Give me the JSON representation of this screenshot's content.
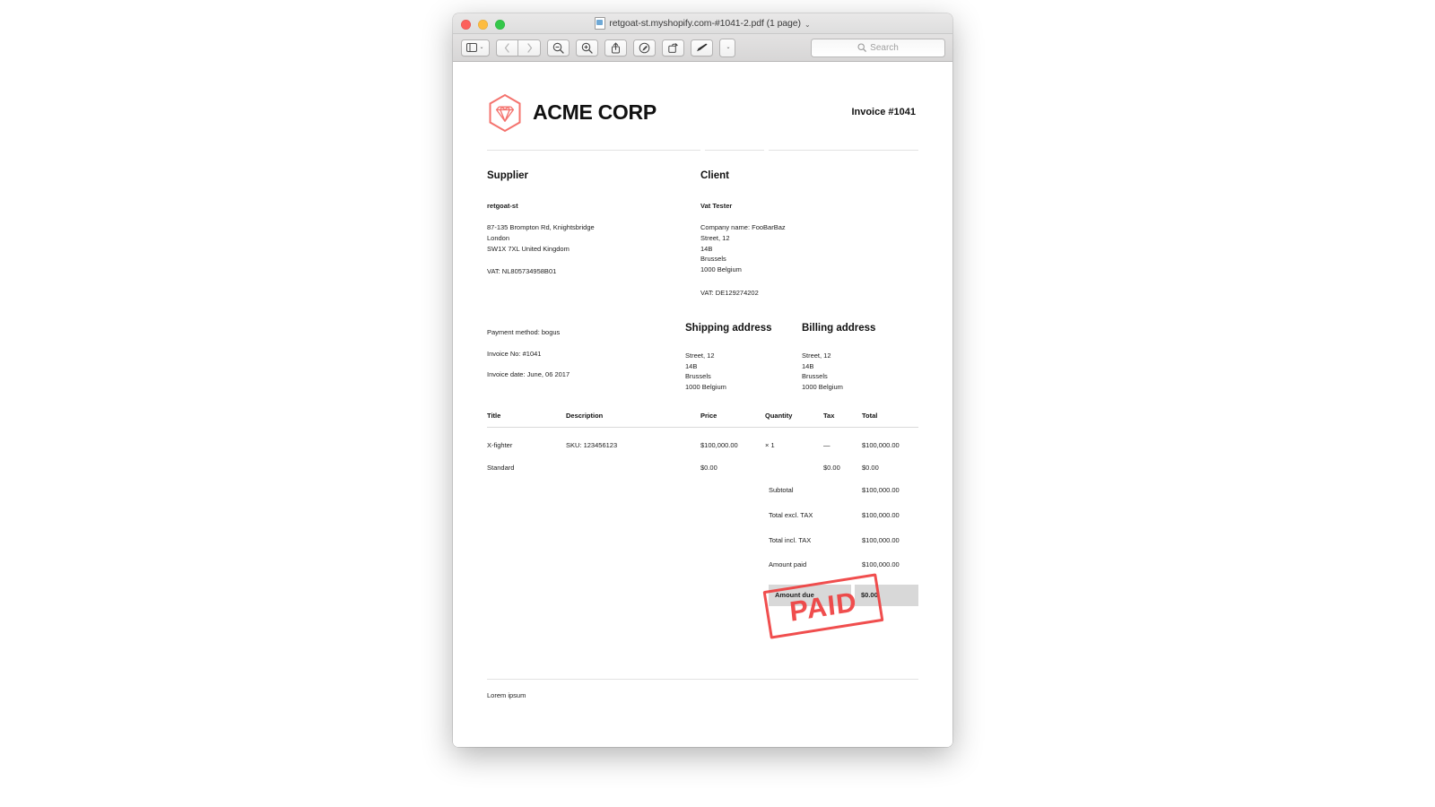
{
  "window": {
    "title": "retgoat-st.myshopify.com-#1041-2.pdf (1 page)",
    "title_chevron": "⌄",
    "traffic_lights": [
      "close",
      "minimize",
      "zoom"
    ]
  },
  "toolbar": {
    "sidebar_label": "Sidebar",
    "back_label": "Back",
    "forward_label": "Forward",
    "zoom_out_label": "Zoom Out",
    "zoom_in_label": "Zoom In",
    "share_label": "Share",
    "markup_label": "Markup",
    "rotate_label": "Rotate",
    "highlight_label": "Highlight",
    "highlight_caret": "⌄",
    "sidebar_caret": "⌄"
  },
  "search": {
    "placeholder": "Search"
  },
  "invoice": {
    "brand_name": "ACME CORP",
    "logo_color": "#f4736e",
    "invoice_number": "Invoice #1041",
    "supplier": {
      "heading": "Supplier",
      "name": "retgoat-st",
      "address": [
        "87-135 Brompton Rd, Knightsbridge",
        "London",
        "SW1X 7XL United Kingdom"
      ],
      "vat": "VAT: NL805734958B01"
    },
    "client": {
      "heading": "Client",
      "name": "Vat Tester",
      "address": [
        "Company name: FooBarBaz",
        "Street, 12",
        "14B",
        "Brussels",
        "1000 Belgium"
      ],
      "vat": "VAT: DE129274202"
    },
    "payment_meta": {
      "payment_method": "Payment method: bogus",
      "invoice_no": "Invoice No: #1041",
      "invoice_date": "Invoice date: June, 06 2017"
    },
    "shipping_address": {
      "heading": "Shipping address",
      "lines": [
        "Street, 12",
        "14B",
        "Brussels",
        "1000 Belgium"
      ]
    },
    "billing_address": {
      "heading": "Billing address",
      "lines": [
        "Street, 12",
        "14B",
        "Brussels",
        "1000 Belgium"
      ]
    },
    "table": {
      "headers": [
        "Title",
        "Description",
        "Price",
        "Quantity",
        "Tax",
        "Total"
      ],
      "rows": [
        {
          "title": "X-fighter",
          "description": "SKU: 123456123",
          "price": "$100,000.00",
          "quantity": "× 1",
          "tax": "—",
          "total": "$100,000.00"
        },
        {
          "title": "Standard",
          "description": "",
          "price": "$0.00",
          "quantity": "",
          "tax": "$0.00",
          "total": "$0.00"
        }
      ]
    },
    "totals": [
      {
        "label": "Subtotal",
        "value": "$100,000.00"
      },
      {
        "label": "Total excl. TAX",
        "value": "$100,000.00"
      },
      {
        "label": "Total incl. TAX",
        "value": "$100,000.00"
      },
      {
        "label": "Amount paid",
        "value": "$100,000.00"
      }
    ],
    "amount_due": {
      "label": "Amount due",
      "value": "$0.00"
    },
    "stamp": {
      "text": "PAID",
      "color": "#ef3b3b"
    },
    "footer_text": "Lorem ipsum"
  }
}
